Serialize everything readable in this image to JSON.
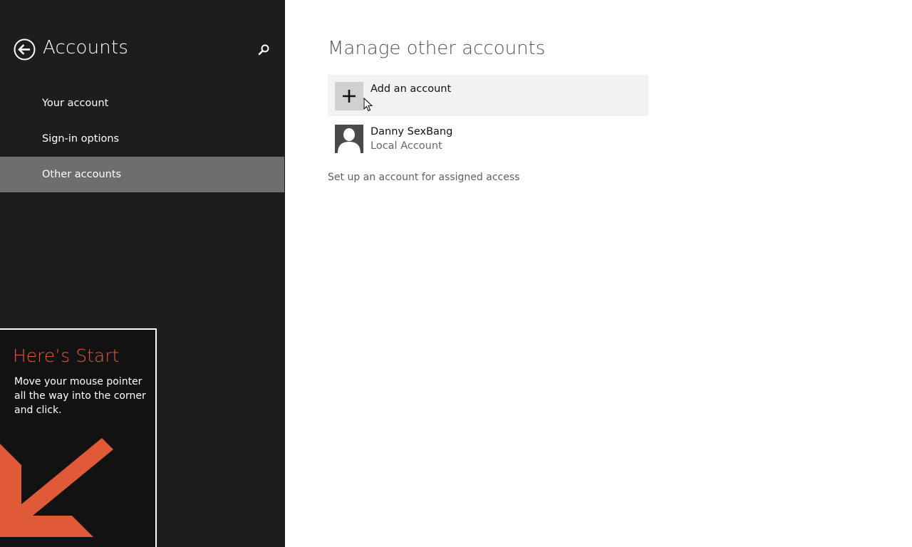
{
  "left_pane": {
    "title": "Accounts",
    "back_icon": "back-arrow-icon",
    "search_icon": "search-icon",
    "nav_items": [
      {
        "label": "Your account",
        "selected": false
      },
      {
        "label": "Sign-in options",
        "selected": false
      },
      {
        "label": "Other accounts",
        "selected": true
      }
    ],
    "background_color": "#1d1d1d",
    "selected_color": "#6e6e6e"
  },
  "start_tip": {
    "title": "Here’s Start",
    "body": "Move your mouse pointer all the way into the corner and click.",
    "accent_color": "#e05a38",
    "arrow_icon": "down-left-arrow-icon"
  },
  "main": {
    "title": "Manage other accounts",
    "add_account": {
      "label": "Add an account",
      "icon": "plus-icon"
    },
    "accounts": [
      {
        "name": "Danny SexBang",
        "type": "Local Account",
        "icon": "user-avatar-icon"
      }
    ],
    "assigned_access_link": "Set up an account for assigned access"
  }
}
